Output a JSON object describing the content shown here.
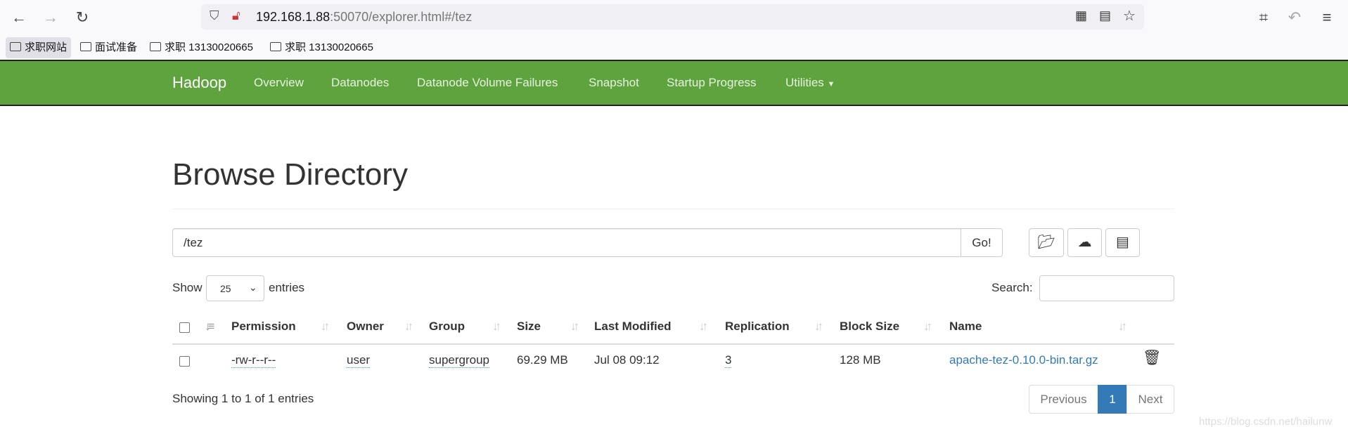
{
  "browser": {
    "url_host": "192.168.1.88",
    "url_rest": ":50070/explorer.html#/tez",
    "bookmarks": [
      "求职网站",
      "面试准备",
      "求职 13130020665",
      "求职 13130020665"
    ]
  },
  "navbar": {
    "brand": "Hadoop",
    "items": [
      "Overview",
      "Datanodes",
      "Datanode Volume Failures",
      "Snapshot",
      "Startup Progress",
      "Utilities"
    ],
    "color": "#5fa33e"
  },
  "page": {
    "title": "Browse Directory",
    "path_value": "/tez",
    "go_label": "Go!"
  },
  "table_controls": {
    "show_label": "Show",
    "entries_value": "25",
    "entries_label": "entries",
    "search_label": "Search:"
  },
  "table": {
    "headers": [
      "Permission",
      "Owner",
      "Group",
      "Size",
      "Last Modified",
      "Replication",
      "Block Size",
      "Name"
    ],
    "rows": [
      {
        "permission": "-rw-r--r--",
        "owner": "user",
        "group": "supergroup",
        "size": "69.29 MB",
        "last_modified": "Jul 08 09:12",
        "replication": "3",
        "block_size": "128 MB",
        "name": "apache-tez-0.10.0-bin.tar.gz"
      }
    ]
  },
  "footer": {
    "info": "Showing 1 to 1 of 1 entries",
    "previous": "Previous",
    "page": "1",
    "next": "Next"
  },
  "watermark": "https://blog.csdn.net/hailunw",
  "accent": "#337ab7"
}
